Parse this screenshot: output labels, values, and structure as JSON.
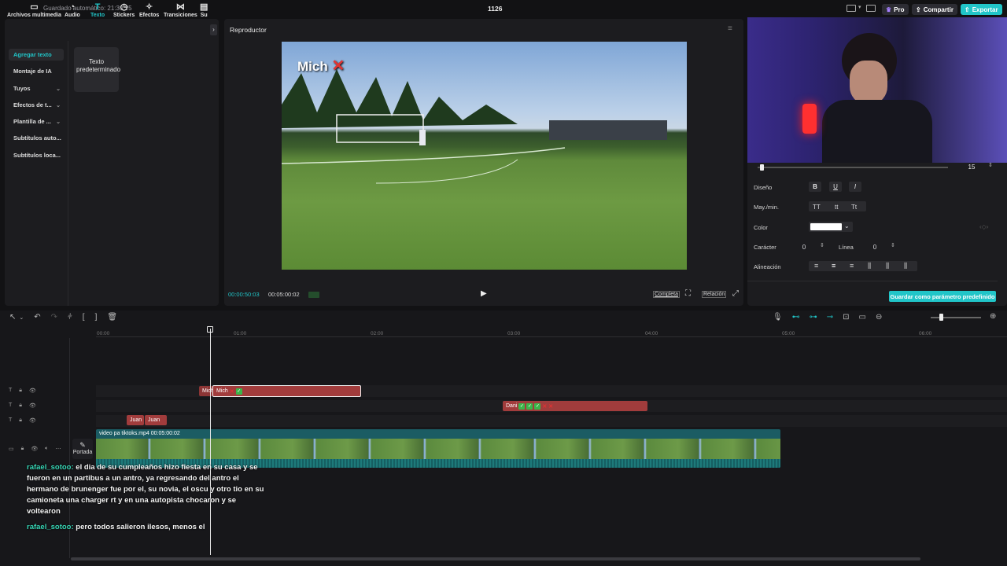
{
  "topbar": {
    "autosave": "Guardado automático: 21:30:25",
    "project_title": "1126",
    "pro_label": "Pro",
    "share_label": "Compartir",
    "export_label": "Exportar"
  },
  "media_tabs": [
    {
      "label": "Archivos multimedia",
      "icon": "media-icon"
    },
    {
      "label": "Audio",
      "icon": "audio-icon"
    },
    {
      "label": "Texto",
      "icon": "text-icon",
      "active": true
    },
    {
      "label": "Stickers",
      "icon": "sticker-icon"
    },
    {
      "label": "Efectos",
      "icon": "effects-icon"
    },
    {
      "label": "Transiciones",
      "icon": "transitions-icon"
    },
    {
      "label": "Su",
      "icon": "subtitles-icon"
    }
  ],
  "sidebar": {
    "items": [
      {
        "label": "Agregar texto",
        "active": true
      },
      {
        "label": "Montaje de IA"
      },
      {
        "label": "Tuyos",
        "chevron": true
      },
      {
        "label": "Efectos de t...",
        "chevron": true
      },
      {
        "label": "Plantilla de ...",
        "chevron": true
      },
      {
        "label": "Subtítulos auto..."
      },
      {
        "label": "Subtítulos loca..."
      }
    ],
    "preset_card": "Texto predeterminado"
  },
  "player": {
    "title": "Reproductor",
    "overlay_text": "Mich",
    "current_time": "00:00:50:03",
    "total_time": "00:05:00:02",
    "full_label": "Completa",
    "ratio_label": "Relación"
  },
  "attributes": {
    "slider_value": "15",
    "design_label": "Diseño",
    "case_label": "May./min.",
    "case_options": [
      "TT",
      "tt",
      "Tt"
    ],
    "color_label": "Color",
    "char_label": "Carácter",
    "char_value": "0",
    "line_label": "Línea",
    "line_value": "0",
    "align_label": "Alineación",
    "save_preset": "Guardar como parámetro predefinido",
    "text_color": "#ffffff"
  },
  "timeline": {
    "ruler": [
      "00:00",
      "01:00",
      "02:00",
      "03:00",
      "04:00",
      "05:00",
      "06:00"
    ],
    "clips": {
      "mich_small": "Mich",
      "mich_main": "Mich",
      "dani": "Dani",
      "juan1": "Juan",
      "juan2": "Juan"
    },
    "video_clip": "video pa tiktoks.mp4   00:05:00:02",
    "cover_label": "Portada"
  },
  "chat": [
    {
      "user": "rafael_sotoo:",
      "text": "el dia de su cumpleaños hizo fiesta en su casa y se fueron en un partibus a un antro, ya regresando del antro el hermano de brunenger fue por el, su novia, el oscu y otro tio en su camioneta una charger rt y en una autopista chocaron y se voltearon"
    },
    {
      "user": "rafael_sotoo:",
      "text": "pero todos salieron ilesos, menos el"
    }
  ],
  "colors": {
    "accent": "#21c5c8",
    "clip_red": "#a13c3c",
    "video_teal": "#1b5c63"
  }
}
